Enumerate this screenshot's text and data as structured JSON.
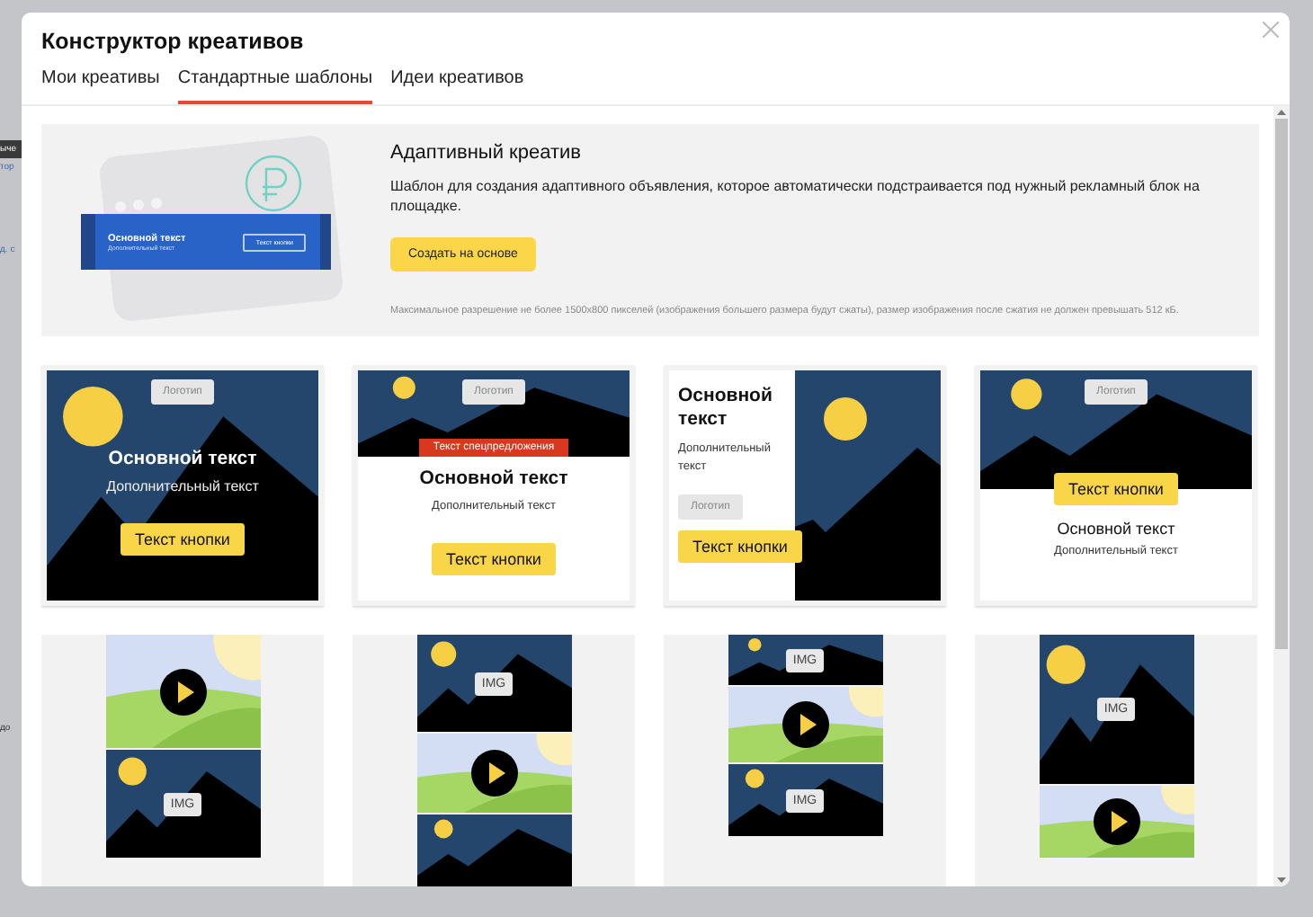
{
  "background": {
    "fragments": [
      {
        "kind": "chip",
        "text": "ыче"
      },
      {
        "kind": "link",
        "text": "тор"
      },
      {
        "kind": "link",
        "text": "д. с"
      },
      {
        "kind": "plain",
        "text": "до"
      }
    ]
  },
  "window": {
    "title": "Конструктор креативов"
  },
  "tabs": [
    {
      "label": "Мои креативы",
      "selected": false
    },
    {
      "label": "Стандартные шаблоны",
      "selected": true
    },
    {
      "label": "Идеи креативов",
      "selected": false
    }
  ],
  "hero": {
    "title": "Адаптивный креатив",
    "description": "Шаблон для создания адаптивного объявления, которое автоматически подстраивается под нужный рекламный блок на площадке.",
    "button": "Создать на основе",
    "note": "Максимальное разрешение не более 1500x800 пикселей (изображения большего размера будут сжаты), размер изображения после сжатия не должен превышать 512 кБ.",
    "preview": {
      "main_text": "Основной текст",
      "secondary_text": "Дополнительный текст",
      "button": "Текст кнопки"
    }
  },
  "templates": [
    {
      "kind": "overlay",
      "logo": "Логотип",
      "main_text": "Основной текст",
      "secondary_text": "Дополнительный текст",
      "button": "Текст кнопки"
    },
    {
      "kind": "ribbon",
      "logo": "Логотип",
      "offer": "Текст спецпредложения",
      "main_text": "Основной текст",
      "secondary_text": "Дополнительный текст",
      "button": "Текст кнопки"
    },
    {
      "kind": "split",
      "main_text": "Основной текст",
      "secondary_text": "Дополнительный текст",
      "logo": "Логотип",
      "button": "Текст кнопки"
    },
    {
      "kind": "banner",
      "logo": "Логотип",
      "button": "Текст кнопки",
      "main_text": "Основной текст",
      "secondary_text": "Дополнительный текст"
    }
  ],
  "video_templates": [
    {
      "panels": [
        {
          "kind": "video"
        },
        {
          "kind": "image",
          "label": "IMG"
        }
      ]
    },
    {
      "panels": [
        {
          "kind": "image",
          "label": "IMG"
        },
        {
          "kind": "video"
        },
        {
          "kind": "image"
        }
      ]
    },
    {
      "panels": [
        {
          "kind": "image",
          "label": "IMG"
        },
        {
          "kind": "video"
        },
        {
          "kind": "image",
          "label": "IMG"
        }
      ]
    },
    {
      "panels": [
        {
          "kind": "image",
          "label": "IMG"
        },
        {
          "kind": "video"
        }
      ]
    }
  ]
}
